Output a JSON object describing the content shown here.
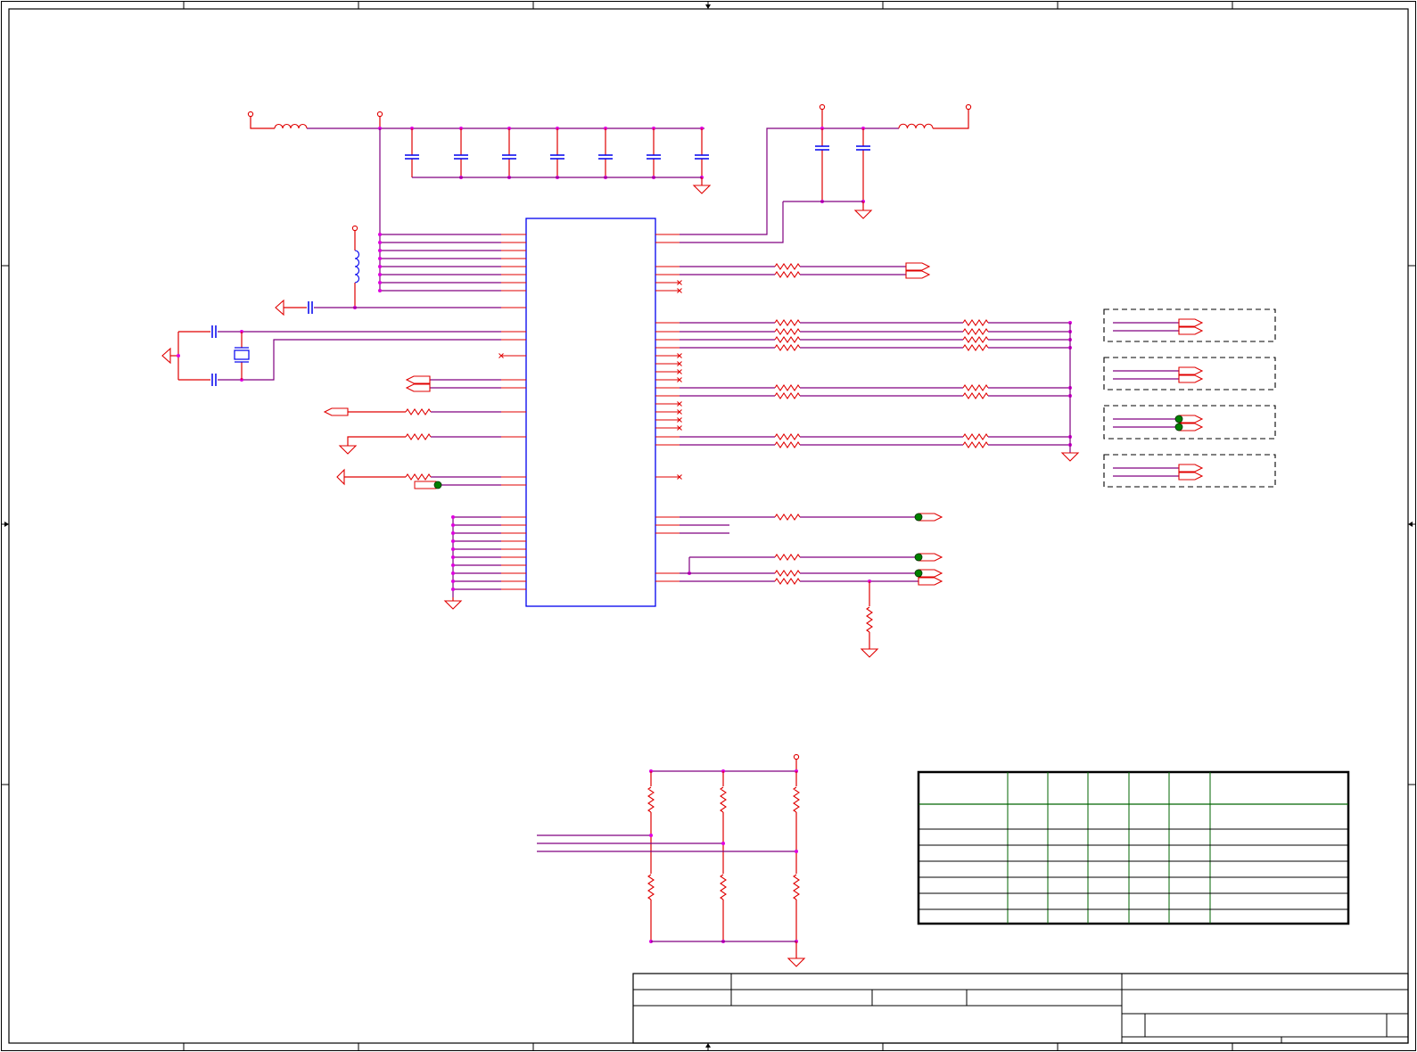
{
  "sheet": {
    "zone_columns": [
      "",
      "",
      "",
      "",
      "",
      "",
      "",
      ""
    ],
    "zone_rows": [
      "",
      "",
      "",
      ""
    ]
  },
  "schematic": {
    "colors": {
      "wire": "#800080",
      "pin": "#e00000",
      "component": "#0000ee",
      "junction": "#e000e0",
      "power": "#e00000",
      "port": "#e00000",
      "test_point": "#008000",
      "frame": "#000000",
      "table_inner_lines": "#006400"
    },
    "ic": {
      "part_label": ""
    },
    "symbols": {
      "inductor_icons": [
        "inductor-icon",
        "inductor-icon",
        "inductor-icon"
      ],
      "capacitor_icon": "capacitor-icon",
      "resistor_icon": "resistor-icon",
      "crystal_icon": "crystal-icon",
      "ground_icon": "ground-icon",
      "power_icon": "power-pin-icon",
      "port_icon": "off-sheet-port-icon",
      "no_connect_icon": "no-connect-icon",
      "test_point_icon": "test-point-icon"
    }
  },
  "strap_table": {
    "rows": 7,
    "columns": 7
  },
  "title_block": {
    "fields": [
      "",
      "",
      "",
      "",
      "",
      "",
      "",
      ""
    ]
  }
}
